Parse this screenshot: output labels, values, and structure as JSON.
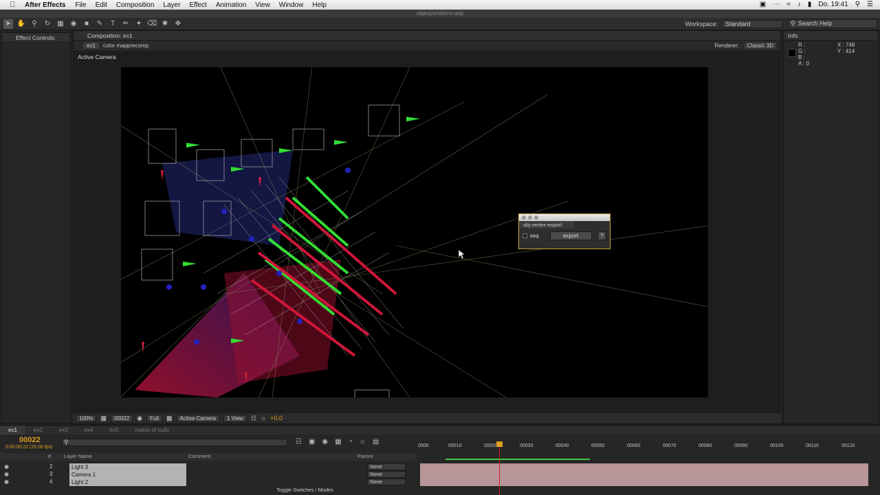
{
  "menubar": {
    "app": "After Effects",
    "items": [
      "File",
      "Edit",
      "Composition",
      "Layer",
      "Effect",
      "Animation",
      "View",
      "Window",
      "Help"
    ],
    "clock": "Do. 19:41"
  },
  "window_title": "objexportdemo.aep",
  "toolbar": {
    "workspace_label": "Workspace:",
    "workspace_value": "Standard",
    "search_placeholder": "Search Help"
  },
  "effect_controls": {
    "tab": "Effect Controls:"
  },
  "composition": {
    "tab": "Composition: ex1",
    "flow": [
      "ex1",
      "color mapprecomp"
    ],
    "renderer_label": "Renderer:",
    "renderer_value": "Classic 3D",
    "view_label": "Active Camera"
  },
  "viewer_controls": {
    "zoom": "100%",
    "timecode": "00022",
    "resolution": "Full",
    "camera": "Active Camera",
    "views": "1 View",
    "exposure": "+0.0"
  },
  "info_panel": {
    "tab": "Info",
    "r": "R :",
    "g": "G :",
    "b": "B :",
    "a": "A : 0",
    "x": "X : 748",
    "y": "Y : 414"
  },
  "plugin": {
    "title": "obj-vertex-export",
    "seq_label": "seq",
    "export_label": "export",
    "help_label": "?"
  },
  "timeline": {
    "tabs": [
      "ex1",
      "ex2",
      "ex3",
      "ex4",
      "ex5",
      "matrix of nulls"
    ],
    "timecode": "00022",
    "timecode_sub": "0:00:00:22 (25.00 fps)",
    "columns": {
      "num": "#",
      "layer": "Layer Name",
      "comment": "Comment",
      "parent": "Parent"
    },
    "layers": [
      {
        "num": "2",
        "name": "Light 3",
        "parent": "None"
      },
      {
        "num": "3",
        "name": "Camera 1",
        "parent": "None"
      },
      {
        "num": "4",
        "name": "Light 2",
        "parent": "None"
      }
    ],
    "ruler": [
      "0000",
      "00010",
      "00020",
      "00030",
      "00040",
      "00050",
      "00060",
      "00070",
      "00080",
      "00090",
      "00100",
      "00110",
      "00120"
    ],
    "toggle_label": "Toggle Switches / Modes"
  }
}
